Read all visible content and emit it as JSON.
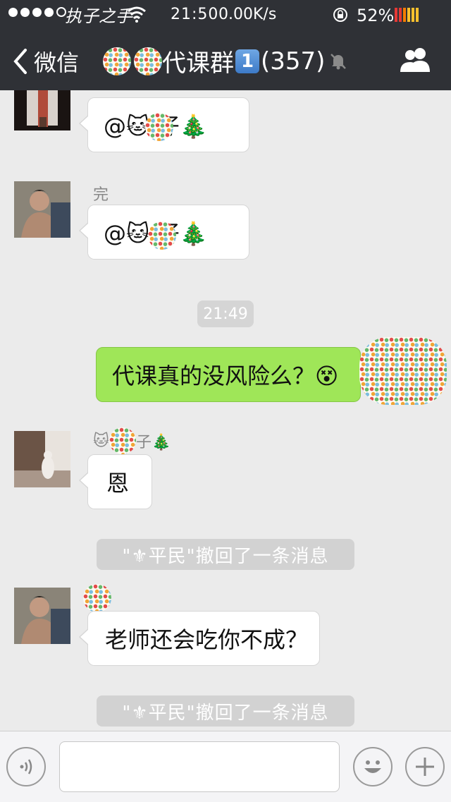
{
  "status_bar": {
    "carrier": "执子之手",
    "time": "21:50",
    "speed": "0.00K/s",
    "battery": "52%"
  },
  "nav": {
    "back_label": "微信",
    "title_text": "代课群",
    "unread_badge": "1",
    "member_count": "(357)"
  },
  "messages": {
    "m1": {
      "text": "@🐱 仔🎄"
    },
    "m2": {
      "sender": "完",
      "text": "@🐱 仔🎄"
    },
    "time1": "21:49",
    "m3": {
      "text": "代课真的没风险么？😵"
    },
    "m4": {
      "sender_cat": "🐱",
      "sender_tail": "子🎄",
      "text": "恩"
    },
    "sys1": "\"⚜平民\"撤回了一条消息",
    "m5": {
      "text": "老师还会吃你不成？"
    },
    "sys2": "\"⚜平民\"撤回了一条消息"
  },
  "input": {
    "value": "",
    "placeholder": ""
  },
  "colors": {
    "navbar_bg": "#2f3136",
    "chat_bg": "#ebebeb",
    "own_bubble": "#9fe658",
    "other_bubble": "#ffffff"
  },
  "icons": {
    "voice": "voice-icon",
    "emoji": "emoji-icon",
    "plus": "plus-icon",
    "group": "group-icon",
    "mute": "mute-icon"
  }
}
